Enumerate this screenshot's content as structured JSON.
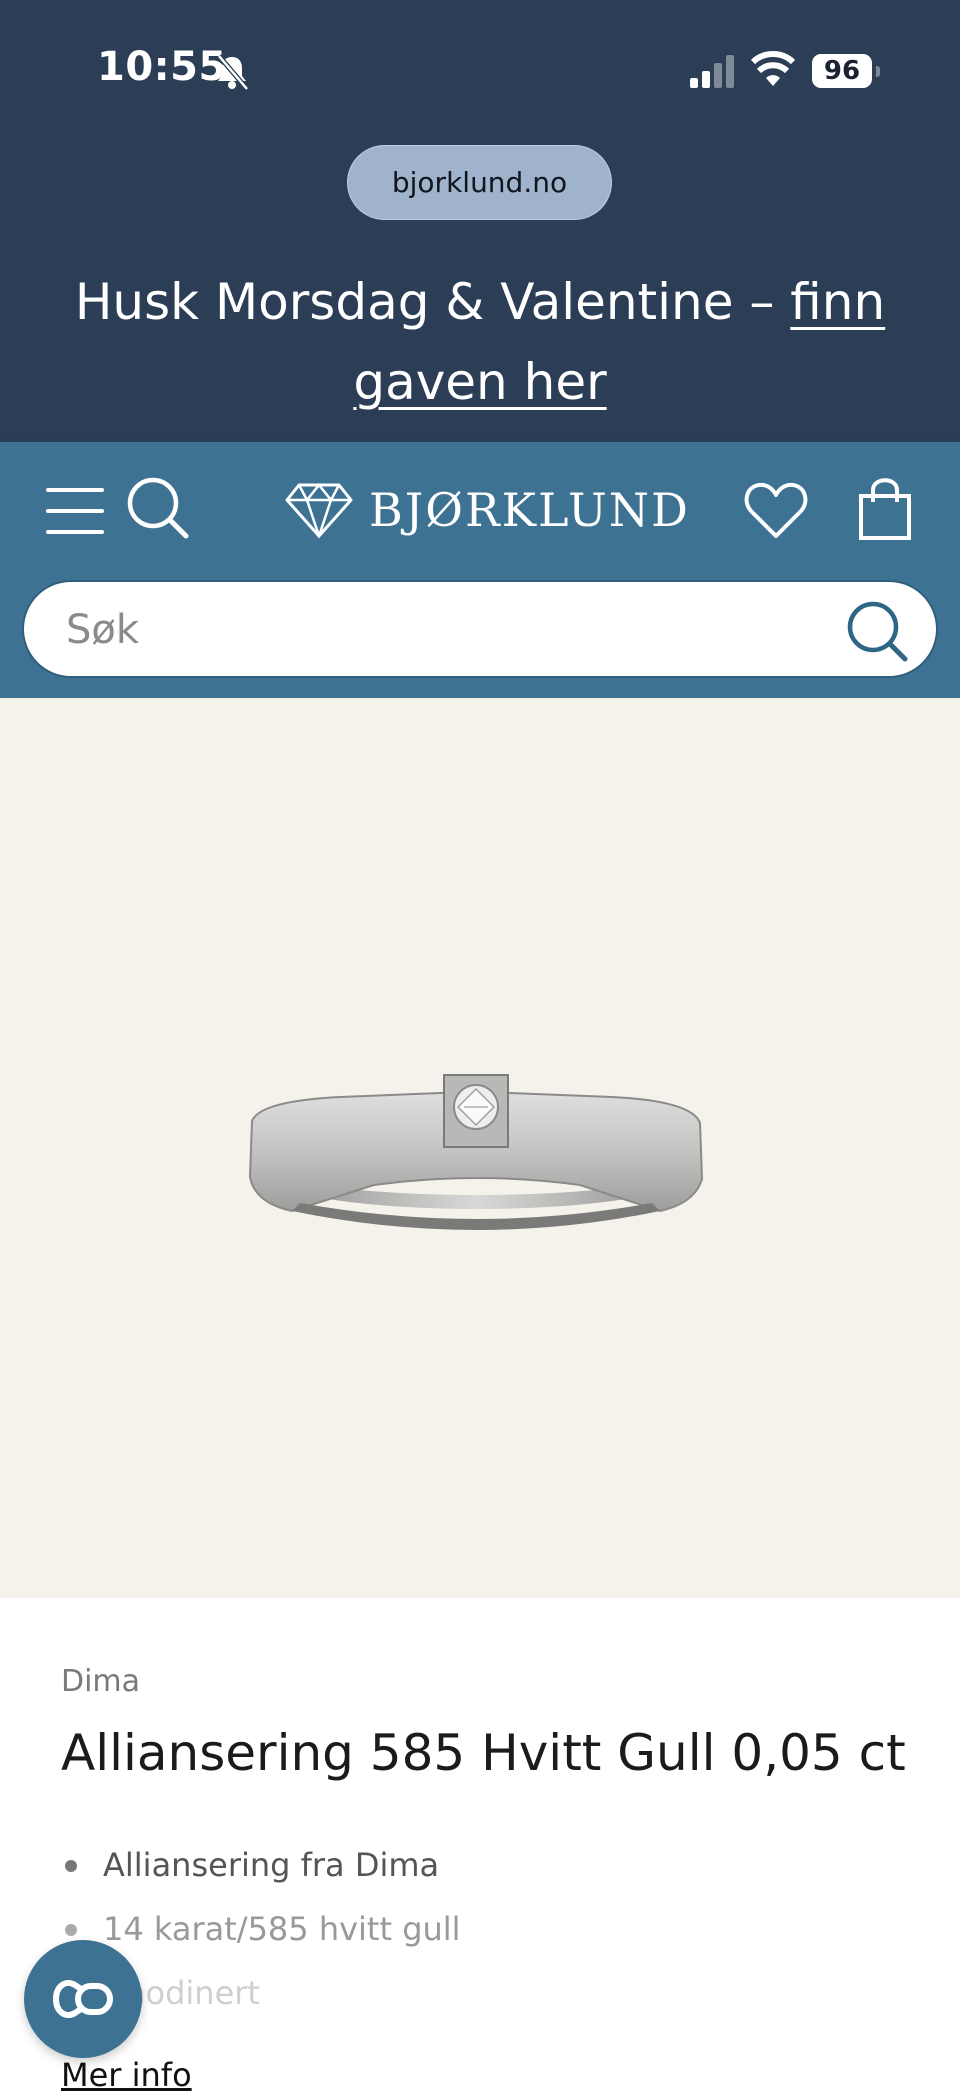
{
  "status_bar": {
    "time": "10:55",
    "battery": "96"
  },
  "browser": {
    "url": "bjorklund.no"
  },
  "promo": {
    "text": "Husk Morsdag & Valentine – ",
    "link": "finn gaven her"
  },
  "header": {
    "logo": "BJØRKLUND",
    "icons": [
      "menu-icon",
      "search-icon",
      "diamond-icon",
      "heart-icon",
      "shopping-bag-icon"
    ]
  },
  "search": {
    "placeholder": "Søk"
  },
  "product": {
    "brand": "Dima",
    "title": "Alliansering 585 Hvitt Gull 0,05 ct",
    "features": [
      "Alliansering fra Dima",
      "14 karat/585 hvitt gull",
      "Rhodinert"
    ],
    "more_info": "Mer info"
  },
  "colors": {
    "top_banner": "#2c3e55",
    "header": "#3e7292",
    "image_background": "#f5f2ec",
    "url_pill": "#9fb3cc"
  }
}
